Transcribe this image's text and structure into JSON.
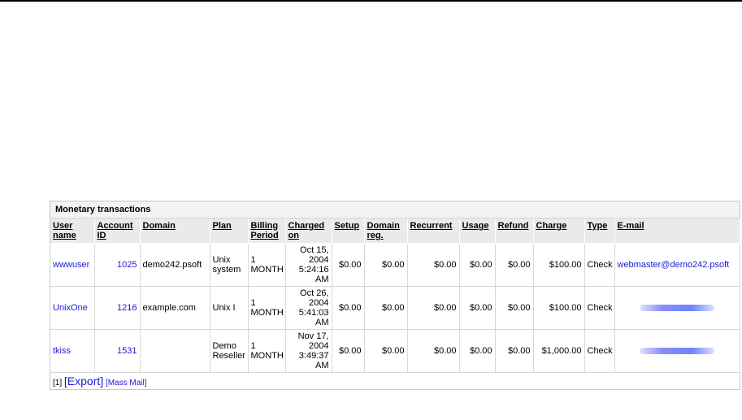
{
  "panel": {
    "title": "Monetary transactions"
  },
  "columns": [
    {
      "key": "user",
      "label": "User name"
    },
    {
      "key": "account",
      "label": "Account ID"
    },
    {
      "key": "domain",
      "label": "Domain"
    },
    {
      "key": "plan",
      "label": "Plan"
    },
    {
      "key": "billing",
      "label": "Billing Period"
    },
    {
      "key": "charged",
      "label": "Charged on"
    },
    {
      "key": "setup",
      "label": "Setup"
    },
    {
      "key": "domreg",
      "label": "Domain reg."
    },
    {
      "key": "recurrent",
      "label": "Recurrent"
    },
    {
      "key": "usage",
      "label": "Usage"
    },
    {
      "key": "refund",
      "label": "Refund"
    },
    {
      "key": "charge",
      "label": "Charge"
    },
    {
      "key": "type",
      "label": "Type"
    },
    {
      "key": "email",
      "label": "E-mail"
    }
  ],
  "rows": [
    {
      "user": "wwwuser",
      "account": "1025",
      "domain": "demo242.psoft",
      "plan": "Unix system",
      "billing": "1 MONTH",
      "charged": "Oct 15, 2004 5:24:16 AM",
      "setup": "$0.00",
      "domreg": "$0.00",
      "recurrent": "$0.00",
      "usage": "$0.00",
      "refund": "$0.00",
      "charge": "$100.00",
      "type": "Check",
      "email": "webmaster@demo242.psoft"
    },
    {
      "user": "UnixOne",
      "account": "1216",
      "domain": "example.com",
      "plan": "Unix I",
      "billing": "1 MONTH",
      "charged": "Oct 26, 2004 5:41:03 AM",
      "setup": "$0.00",
      "domreg": "$0.00",
      "recurrent": "$0.00",
      "usage": "$0.00",
      "refund": "$0.00",
      "charge": "$100.00",
      "type": "Check",
      "email": ""
    },
    {
      "user": "tkiss",
      "account": "1531",
      "domain": "",
      "plan": "Demo Reseller",
      "billing": "1 MONTH",
      "charged": "Nov 17, 2004 3:49:37 AM",
      "setup": "$0.00",
      "domreg": "$0.00",
      "recurrent": "$0.00",
      "usage": "$0.00",
      "refund": "$0.00",
      "charge": "$1,000.00",
      "type": "Check",
      "email": ""
    }
  ],
  "footer": {
    "page": "[1]",
    "export": "[Export]",
    "mass_mail": "[Mass Mail]"
  },
  "colors": {
    "link": "#1a1ad6",
    "header_bg": "#eaeaea",
    "border": "#c8c8c8"
  }
}
